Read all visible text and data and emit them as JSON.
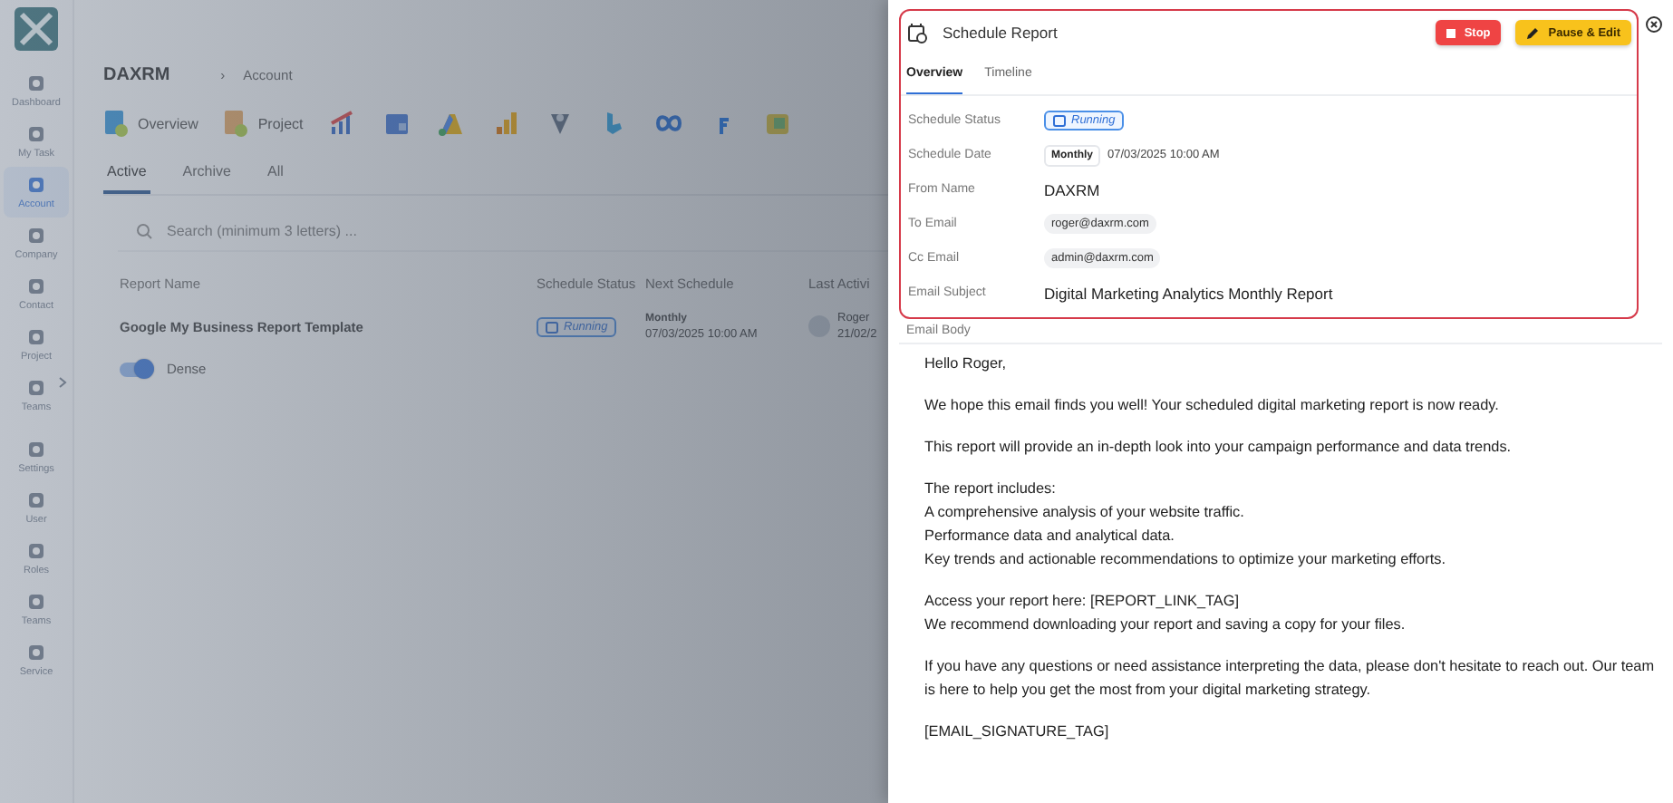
{
  "sidebar": {
    "items": [
      {
        "label": "Dashboard",
        "selected": false,
        "expandable": false
      },
      {
        "label": "My Task",
        "selected": false,
        "expandable": false
      },
      {
        "label": "Account",
        "selected": true,
        "expandable": false
      },
      {
        "label": "Company",
        "selected": false,
        "expandable": false
      },
      {
        "label": "Contact",
        "selected": false,
        "expandable": false
      },
      {
        "label": "Project",
        "selected": false,
        "expandable": false
      },
      {
        "label": "Teams",
        "selected": false,
        "expandable": true
      },
      {
        "label": "Settings",
        "selected": false,
        "expandable": false
      },
      {
        "label": "User",
        "selected": false,
        "expandable": false
      },
      {
        "label": "Roles",
        "selected": false,
        "expandable": false
      },
      {
        "label": "Teams",
        "selected": false,
        "expandable": false
      },
      {
        "label": "Service",
        "selected": false,
        "expandable": false
      }
    ]
  },
  "main": {
    "brand": "DAXRM",
    "breadcrumb_separator": "›",
    "breadcrumb": "Account",
    "nav_links": [
      "Overview",
      "Project"
    ],
    "tabs": [
      {
        "label": "Active",
        "selected": true
      },
      {
        "label": "Archive",
        "selected": false
      },
      {
        "label": "All",
        "selected": false
      }
    ],
    "search": {
      "placeholder": "Search (minimum 3 letters) ..."
    },
    "table": {
      "columns": [
        "Report Name",
        "Schedule Status",
        "Next Schedule",
        "Last Activi"
      ],
      "rows": [
        {
          "report_name": "Google My Business Report Template",
          "status": "Running",
          "frequency": "Monthly",
          "next_date": "07/03/2025 10:00 AM",
          "last_activity_name": "Roger",
          "last_activity_date": "21/02/2"
        }
      ]
    },
    "dense_toggle": {
      "label": "Dense",
      "on": true
    }
  },
  "drawer": {
    "title": "Schedule Report",
    "buttons": [
      {
        "label": "Stop",
        "kind": "danger"
      },
      {
        "label": "Pause & Edit",
        "kind": "warning"
      }
    ],
    "tabs": [
      {
        "label": "Overview",
        "selected": true
      },
      {
        "label": "Timeline",
        "selected": false
      }
    ],
    "fields": [
      {
        "label": "Schedule Status",
        "kind": "status",
        "value": "Running"
      },
      {
        "label": "Schedule Date",
        "kind": "schedule",
        "frequency": "Monthly",
        "value": "07/03/2025 10:00 AM"
      },
      {
        "label": "From Name",
        "kind": "text",
        "value": "DAXRM"
      },
      {
        "label": "To Email",
        "kind": "chip",
        "value": "roger@daxrm.com"
      },
      {
        "label": "Cc Email",
        "kind": "chip",
        "value": "admin@daxrm.com"
      },
      {
        "label": "Email Subject",
        "kind": "text",
        "value": "Digital Marketing Analytics Monthly Report"
      }
    ],
    "email_body": {
      "label": "Email Body",
      "paragraphs": [
        [
          "Hello Roger,"
        ],
        [
          "We hope this email finds you well! Your scheduled digital marketing report is now ready."
        ],
        [
          "This report will provide an in-depth look into your campaign performance and data trends."
        ],
        [
          "The report includes:",
          "A comprehensive analysis of your website traffic.",
          "Performance data and analytical data.",
          "Key trends and actionable recommendations to optimize your marketing efforts."
        ],
        [
          "Access your report here: [REPORT_LINK_TAG]",
          "We recommend downloading your report and saving a copy for your files."
        ],
        [
          "If you have any questions or need assistance interpreting the data, please don't hesitate to reach out. Our team",
          "is here to help you get the most from your digital marketing strategy."
        ],
        [
          "[EMAIL_SIGNATURE_TAG]"
        ]
      ]
    }
  }
}
